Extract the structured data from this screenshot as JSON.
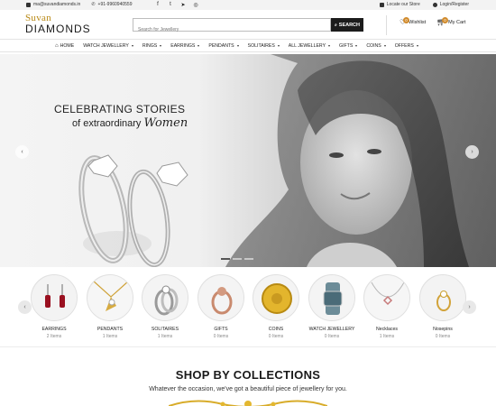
{
  "topbar": {
    "email": "ma@suvandiamonds.in",
    "phone": "+91-9960940559",
    "social": [
      {
        "icon": "facebook-icon",
        "glyph": "f"
      },
      {
        "icon": "twitter-icon",
        "glyph": "t"
      },
      {
        "icon": "telegram-icon",
        "glyph": "➤"
      },
      {
        "icon": "instagram-icon",
        "glyph": "◎"
      }
    ],
    "locate_store": "Locate our Store",
    "login": "Login/Register"
  },
  "header": {
    "logo_line1": "Suvan",
    "logo_line2": "DIAMONDS",
    "search_placeholder": "Search for Jewellery",
    "search_button": "SEARCH",
    "wishlist_label": "Wishlist",
    "wishlist_count": "0",
    "cart_label": "My Cart",
    "cart_count": "0"
  },
  "nav": {
    "items": [
      {
        "label": "HOME",
        "caret": false
      },
      {
        "label": "WATCH JEWELLERY",
        "caret": true
      },
      {
        "label": "RINGS",
        "caret": true
      },
      {
        "label": "EARRINGS",
        "caret": true
      },
      {
        "label": "PENDANTS",
        "caret": true
      },
      {
        "label": "SOLITAIRES",
        "caret": true
      },
      {
        "label": "ALL JEWELLERY",
        "caret": true
      },
      {
        "label": "GIFTS",
        "caret": true
      },
      {
        "label": "COINS",
        "caret": true
      },
      {
        "label": "OFFERS",
        "caret": true
      }
    ]
  },
  "hero": {
    "line1": "CELEBRATING STORIES",
    "line2": "of extraordinary",
    "line2_script": "Women",
    "slide_count": 3,
    "active_slide": 0
  },
  "categories": [
    {
      "name": "EARRINGS",
      "count": "2 Items",
      "icon": "earrings-icon"
    },
    {
      "name": "PENDANTS",
      "count": "1 Items",
      "icon": "pendant-icon"
    },
    {
      "name": "SOLITAIRES",
      "count": "1 Items",
      "icon": "solitaire-ring-icon"
    },
    {
      "name": "GIFTS",
      "count": "0 Items",
      "icon": "gift-ring-icon"
    },
    {
      "name": "COINS",
      "count": "0 Items",
      "icon": "coin-icon"
    },
    {
      "name": "WATCH JEWELLERY",
      "count": "0 Items",
      "icon": "watch-icon"
    },
    {
      "name": "Necklaces",
      "count": "1 Items",
      "icon": "necklace-icon"
    },
    {
      "name": "Nosepins",
      "count": "0 Items",
      "icon": "nosepin-icon"
    }
  ],
  "collections": {
    "title": "SHOP BY COLLECTIONS",
    "subtitle": "Whatever the occasion, we've got a beautiful piece of jewellery for you."
  },
  "colors": {
    "gold": "#b98a17",
    "badge": "#d18b2c",
    "dark": "#1c1c1c"
  }
}
